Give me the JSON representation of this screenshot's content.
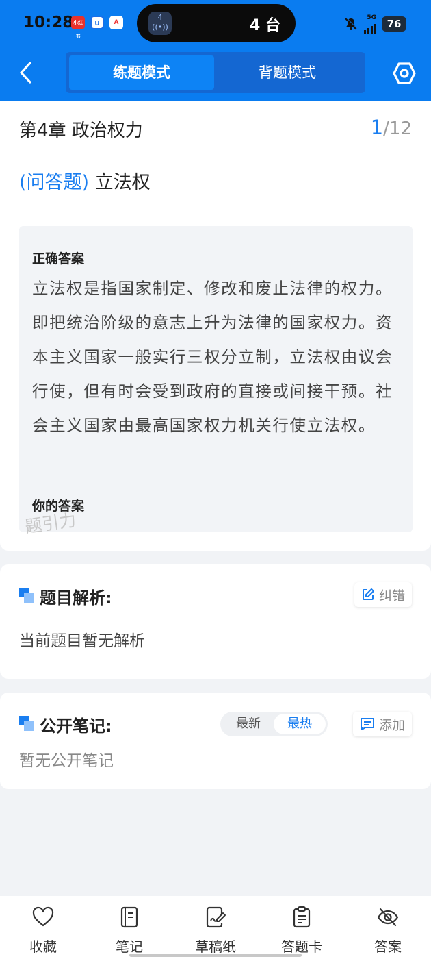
{
  "status_bar": {
    "time": "10:28",
    "app_badges": [
      "小红书",
      "U",
      "A"
    ],
    "island_count": "4",
    "island_text": "4 台",
    "network": "5G",
    "battery": "76"
  },
  "header": {
    "mode_active": "练题模式",
    "mode_inactive": "背题模式",
    "accent": "#0a7cf0"
  },
  "question": {
    "chapter": "第4章 政治权力",
    "current": "1",
    "total": "/12",
    "type": "(问答题)",
    "title": "立法权",
    "correct_heading": "正确答案",
    "correct_answer": "立法权是指国家制定、修改和废止法律的权力。即把统治阶级的意志上升为法律的国家权力。资本主义国家一般实行三权分立制，立法权由议会行使，但有时会受到政府的直接或间接干预。社会主义国家由最高国家权力机关行使立法权。",
    "your_heading": "你的答案",
    "watermark": "题引力"
  },
  "analysis": {
    "title": "题目解析:",
    "fix_label": "纠错",
    "empty_text": "当前题目暂无解析"
  },
  "notes": {
    "title": "公开笔记:",
    "sort_latest": "最新",
    "sort_hot": "最热",
    "add_label": "添加",
    "empty_text": "暂无公开笔记"
  },
  "toolbar": {
    "favorite": "收藏",
    "notes": "笔记",
    "draft": "草稿纸",
    "answer_card": "答题卡",
    "answer": "答案"
  }
}
